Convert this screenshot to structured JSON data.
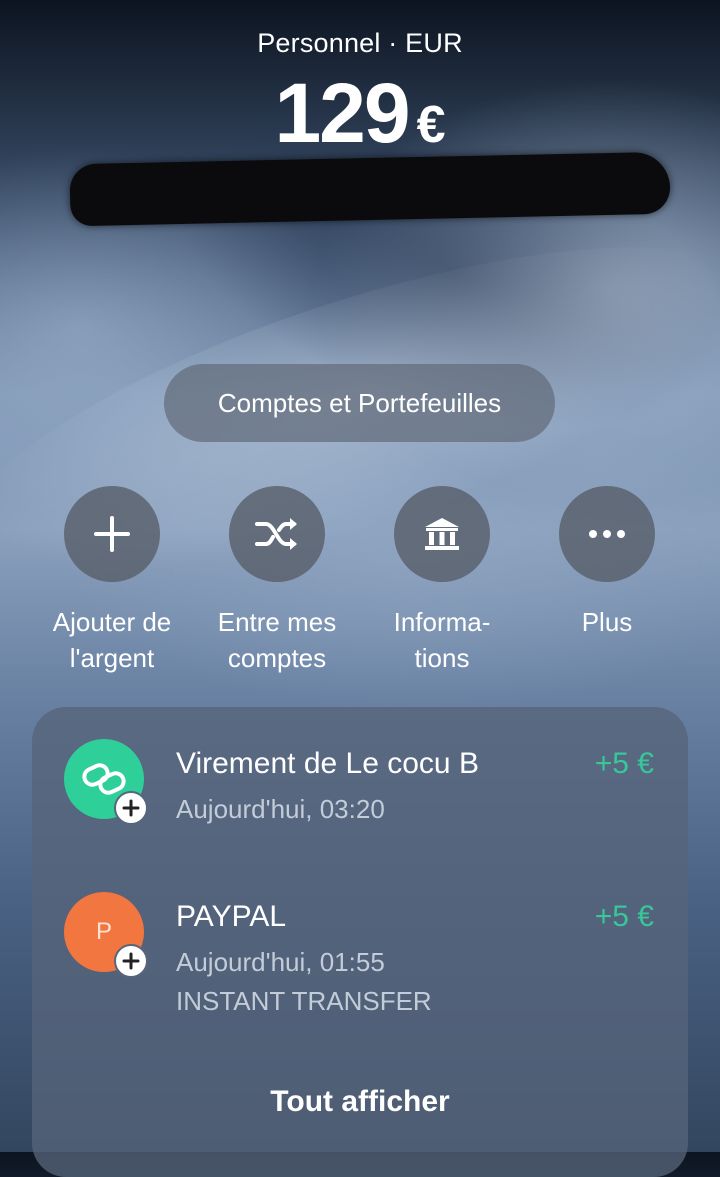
{
  "header": {
    "account_label": "Personnel · EUR",
    "balance_value": "129",
    "balance_currency": "€"
  },
  "accounts_button": {
    "label": "Comptes et Portefeuilles"
  },
  "actions": [
    {
      "label_line1": "Ajouter de",
      "label_line2": "l'argent",
      "icon": "plus-icon"
    },
    {
      "label_line1": "Entre mes",
      "label_line2": "comptes",
      "icon": "shuffle-icon"
    },
    {
      "label_line1": "Informa-",
      "label_line2": "tions",
      "icon": "bank-icon"
    },
    {
      "label_line1": "Plus",
      "label_line2": "",
      "icon": "more-icon"
    }
  ],
  "transactions": [
    {
      "title": "Virement de Le cocu B",
      "date": "Aujourd'hui, 03:20",
      "detail": "",
      "amount": "+5 €",
      "avatar_color": "#2ecf98",
      "avatar_icon": "link-icon"
    },
    {
      "title": "PAYPAL",
      "date": "Aujourd'hui, 01:55",
      "detail": "INSTANT TRANSFER",
      "amount": "+5 €",
      "avatar_color": "#f2763f",
      "avatar_letter": "P"
    }
  ],
  "see_all": {
    "label": "Tout afficher"
  },
  "colors": {
    "positive_amount": "#37c79a",
    "redaction": "#0b0b0e"
  }
}
